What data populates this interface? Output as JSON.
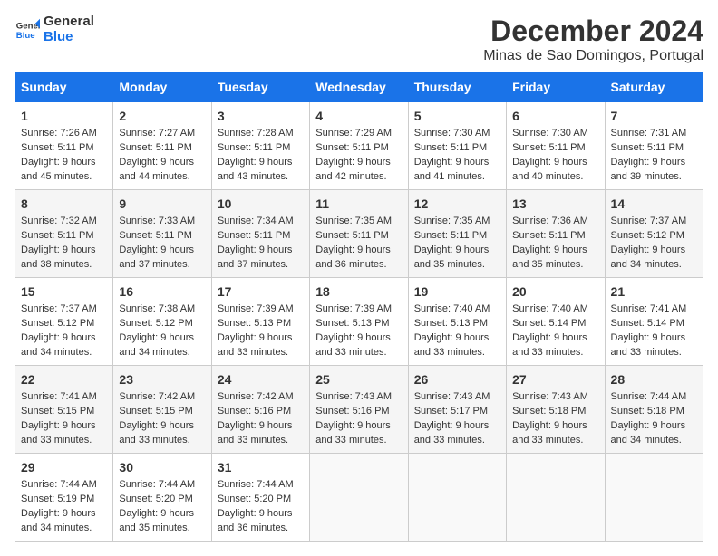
{
  "logo": {
    "line1": "General",
    "line2": "Blue"
  },
  "title": "December 2024",
  "subtitle": "Minas de Sao Domingos, Portugal",
  "days_of_week": [
    "Sunday",
    "Monday",
    "Tuesday",
    "Wednesday",
    "Thursday",
    "Friday",
    "Saturday"
  ],
  "weeks": [
    [
      {
        "day": "1",
        "sunrise": "Sunrise: 7:26 AM",
        "sunset": "Sunset: 5:11 PM",
        "daylight": "Daylight: 9 hours and 45 minutes."
      },
      {
        "day": "2",
        "sunrise": "Sunrise: 7:27 AM",
        "sunset": "Sunset: 5:11 PM",
        "daylight": "Daylight: 9 hours and 44 minutes."
      },
      {
        "day": "3",
        "sunrise": "Sunrise: 7:28 AM",
        "sunset": "Sunset: 5:11 PM",
        "daylight": "Daylight: 9 hours and 43 minutes."
      },
      {
        "day": "4",
        "sunrise": "Sunrise: 7:29 AM",
        "sunset": "Sunset: 5:11 PM",
        "daylight": "Daylight: 9 hours and 42 minutes."
      },
      {
        "day": "5",
        "sunrise": "Sunrise: 7:30 AM",
        "sunset": "Sunset: 5:11 PM",
        "daylight": "Daylight: 9 hours and 41 minutes."
      },
      {
        "day": "6",
        "sunrise": "Sunrise: 7:30 AM",
        "sunset": "Sunset: 5:11 PM",
        "daylight": "Daylight: 9 hours and 40 minutes."
      },
      {
        "day": "7",
        "sunrise": "Sunrise: 7:31 AM",
        "sunset": "Sunset: 5:11 PM",
        "daylight": "Daylight: 9 hours and 39 minutes."
      }
    ],
    [
      {
        "day": "8",
        "sunrise": "Sunrise: 7:32 AM",
        "sunset": "Sunset: 5:11 PM",
        "daylight": "Daylight: 9 hours and 38 minutes."
      },
      {
        "day": "9",
        "sunrise": "Sunrise: 7:33 AM",
        "sunset": "Sunset: 5:11 PM",
        "daylight": "Daylight: 9 hours and 37 minutes."
      },
      {
        "day": "10",
        "sunrise": "Sunrise: 7:34 AM",
        "sunset": "Sunset: 5:11 PM",
        "daylight": "Daylight: 9 hours and 37 minutes."
      },
      {
        "day": "11",
        "sunrise": "Sunrise: 7:35 AM",
        "sunset": "Sunset: 5:11 PM",
        "daylight": "Daylight: 9 hours and 36 minutes."
      },
      {
        "day": "12",
        "sunrise": "Sunrise: 7:35 AM",
        "sunset": "Sunset: 5:11 PM",
        "daylight": "Daylight: 9 hours and 35 minutes."
      },
      {
        "day": "13",
        "sunrise": "Sunrise: 7:36 AM",
        "sunset": "Sunset: 5:11 PM",
        "daylight": "Daylight: 9 hours and 35 minutes."
      },
      {
        "day": "14",
        "sunrise": "Sunrise: 7:37 AM",
        "sunset": "Sunset: 5:12 PM",
        "daylight": "Daylight: 9 hours and 34 minutes."
      }
    ],
    [
      {
        "day": "15",
        "sunrise": "Sunrise: 7:37 AM",
        "sunset": "Sunset: 5:12 PM",
        "daylight": "Daylight: 9 hours and 34 minutes."
      },
      {
        "day": "16",
        "sunrise": "Sunrise: 7:38 AM",
        "sunset": "Sunset: 5:12 PM",
        "daylight": "Daylight: 9 hours and 34 minutes."
      },
      {
        "day": "17",
        "sunrise": "Sunrise: 7:39 AM",
        "sunset": "Sunset: 5:13 PM",
        "daylight": "Daylight: 9 hours and 33 minutes."
      },
      {
        "day": "18",
        "sunrise": "Sunrise: 7:39 AM",
        "sunset": "Sunset: 5:13 PM",
        "daylight": "Daylight: 9 hours and 33 minutes."
      },
      {
        "day": "19",
        "sunrise": "Sunrise: 7:40 AM",
        "sunset": "Sunset: 5:13 PM",
        "daylight": "Daylight: 9 hours and 33 minutes."
      },
      {
        "day": "20",
        "sunrise": "Sunrise: 7:40 AM",
        "sunset": "Sunset: 5:14 PM",
        "daylight": "Daylight: 9 hours and 33 minutes."
      },
      {
        "day": "21",
        "sunrise": "Sunrise: 7:41 AM",
        "sunset": "Sunset: 5:14 PM",
        "daylight": "Daylight: 9 hours and 33 minutes."
      }
    ],
    [
      {
        "day": "22",
        "sunrise": "Sunrise: 7:41 AM",
        "sunset": "Sunset: 5:15 PM",
        "daylight": "Daylight: 9 hours and 33 minutes."
      },
      {
        "day": "23",
        "sunrise": "Sunrise: 7:42 AM",
        "sunset": "Sunset: 5:15 PM",
        "daylight": "Daylight: 9 hours and 33 minutes."
      },
      {
        "day": "24",
        "sunrise": "Sunrise: 7:42 AM",
        "sunset": "Sunset: 5:16 PM",
        "daylight": "Daylight: 9 hours and 33 minutes."
      },
      {
        "day": "25",
        "sunrise": "Sunrise: 7:43 AM",
        "sunset": "Sunset: 5:16 PM",
        "daylight": "Daylight: 9 hours and 33 minutes."
      },
      {
        "day": "26",
        "sunrise": "Sunrise: 7:43 AM",
        "sunset": "Sunset: 5:17 PM",
        "daylight": "Daylight: 9 hours and 33 minutes."
      },
      {
        "day": "27",
        "sunrise": "Sunrise: 7:43 AM",
        "sunset": "Sunset: 5:18 PM",
        "daylight": "Daylight: 9 hours and 33 minutes."
      },
      {
        "day": "28",
        "sunrise": "Sunrise: 7:44 AM",
        "sunset": "Sunset: 5:18 PM",
        "daylight": "Daylight: 9 hours and 34 minutes."
      }
    ],
    [
      {
        "day": "29",
        "sunrise": "Sunrise: 7:44 AM",
        "sunset": "Sunset: 5:19 PM",
        "daylight": "Daylight: 9 hours and 34 minutes."
      },
      {
        "day": "30",
        "sunrise": "Sunrise: 7:44 AM",
        "sunset": "Sunset: 5:20 PM",
        "daylight": "Daylight: 9 hours and 35 minutes."
      },
      {
        "day": "31",
        "sunrise": "Sunrise: 7:44 AM",
        "sunset": "Sunset: 5:20 PM",
        "daylight": "Daylight: 9 hours and 36 minutes."
      },
      null,
      null,
      null,
      null
    ]
  ]
}
